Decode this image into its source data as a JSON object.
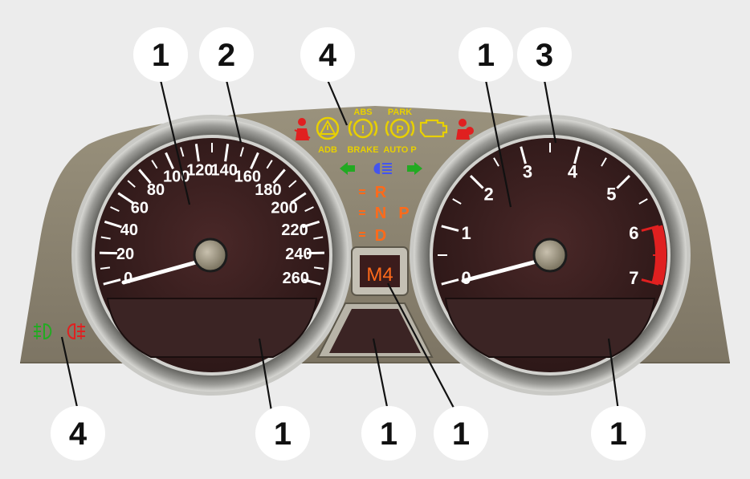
{
  "speedometer": {
    "ticks": [
      "0",
      "20",
      "40",
      "60",
      "80",
      "100",
      "120",
      "140",
      "160",
      "180",
      "200",
      "220",
      "240",
      "260"
    ],
    "needle_value": "0"
  },
  "tachometer": {
    "ticks": [
      "0",
      "1",
      "2",
      "3",
      "4",
      "5",
      "6",
      "7"
    ],
    "redline_from": 6.0
  },
  "warning_lights": {
    "adb_label": "ADB",
    "abs_label": "ABS",
    "brake_label": "BRAKE",
    "park_label": "PARK",
    "auto_p_label": "AUTO P"
  },
  "gear_indicator": {
    "r": "R",
    "n": "N",
    "p": "P",
    "d": "D",
    "display": "M4"
  },
  "callouts": [
    "1",
    "2",
    "4",
    "1",
    "3",
    "4",
    "1",
    "1",
    "1",
    "1"
  ],
  "colors": {
    "housing": "#8a826e",
    "dial_face": "#3a2020",
    "yellow": "#e8d000",
    "red": "#e02020",
    "orange": "#ff6a1a",
    "green": "#22aa22",
    "blue": "#4455ee"
  }
}
